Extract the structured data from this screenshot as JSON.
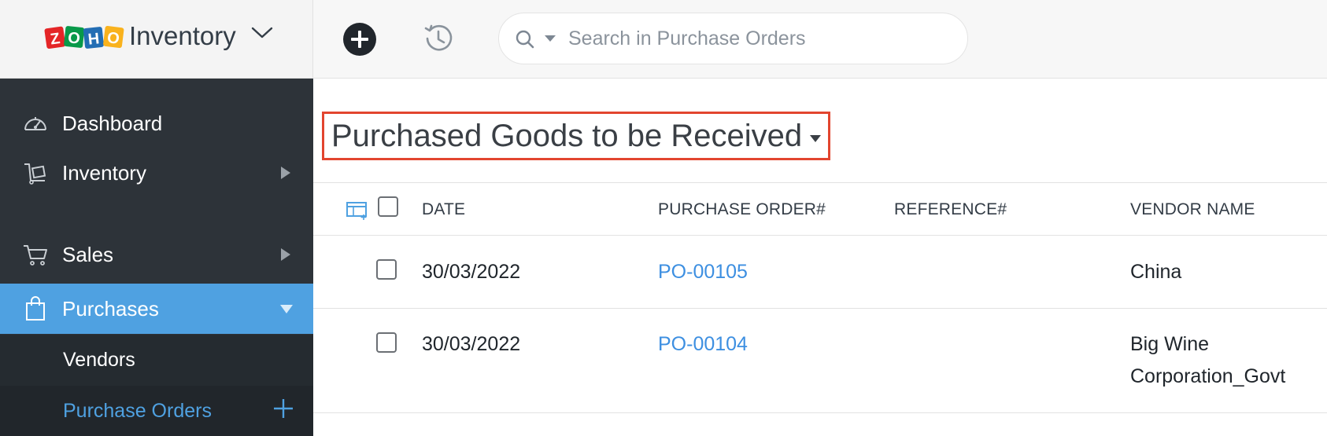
{
  "app": {
    "brand": "Inventory",
    "logo_letters": [
      "Z",
      "O",
      "H",
      "O"
    ],
    "logo_colors": [
      "#e42527",
      "#089949",
      "#226db4",
      "#f9b21d"
    ]
  },
  "sidebar": {
    "items": [
      {
        "label": "Dashboard",
        "icon": "dashboard-icon"
      },
      {
        "label": "Inventory",
        "icon": "inventory-icon"
      },
      {
        "label": "Sales",
        "icon": "cart-icon"
      },
      {
        "label": "Purchases",
        "icon": "shopping-bag-icon"
      }
    ],
    "sub_items": [
      {
        "label": "Vendors"
      },
      {
        "label": "Purchase Orders"
      }
    ]
  },
  "topbar": {
    "search_placeholder": "Search in Purchase Orders"
  },
  "main": {
    "view_title": "Purchased Goods to be Received",
    "columns": [
      "DATE",
      "PURCHASE ORDER#",
      "REFERENCE#",
      "VENDOR NAME"
    ],
    "rows": [
      {
        "date": "30/03/2022",
        "po": "PO-00105",
        "reference": "",
        "vendor_line1": "China",
        "vendor_line2": ""
      },
      {
        "date": "30/03/2022",
        "po": "PO-00104",
        "reference": "",
        "vendor_line1": "Big Wine",
        "vendor_line2": "Corporation_Govt"
      }
    ]
  },
  "colors": {
    "sidebar_bg": "#2d3339",
    "active_blue": "#4fa1e1",
    "link_blue": "#3d8fe1",
    "highlight_red": "#e2452f"
  }
}
